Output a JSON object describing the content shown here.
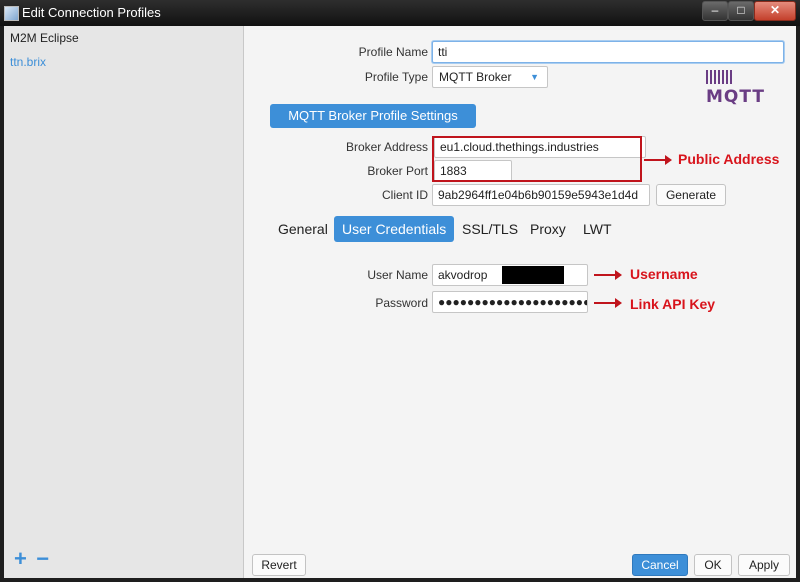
{
  "window": {
    "title": "Edit Connection Profiles",
    "minimize": "‒",
    "maximize": "□",
    "close": "✕"
  },
  "sidebar": {
    "profiles": [
      {
        "label": "M2M Eclipse"
      },
      {
        "label": "ttn.brix"
      }
    ],
    "add": "+",
    "remove": "−"
  },
  "profile": {
    "name_label": "Profile Name",
    "name_value": "tti",
    "type_label": "Profile Type",
    "type_value": "MQTT Broker"
  },
  "logo": {
    "text": "MQTT"
  },
  "section": {
    "title": "MQTT Broker Profile Settings"
  },
  "broker": {
    "address_label": "Broker Address",
    "address_value": "eu1.cloud.thethings.industries",
    "port_label": "Broker Port",
    "port_value": "1883",
    "client_label": "Client ID",
    "client_value": "9ab2964ff1e04b6b90159e5943e1d4d",
    "generate_label": "Generate"
  },
  "tabs": [
    {
      "label": "General"
    },
    {
      "label": "User Credentials"
    },
    {
      "label": "SSL/TLS"
    },
    {
      "label": "Proxy"
    },
    {
      "label": "LWT"
    }
  ],
  "credentials": {
    "username_label": "User Name",
    "username_value": "akvodrop",
    "password_label": "Password",
    "password_value": "●●●●●●●●●●●●●●●●●●●●●"
  },
  "annotations": {
    "public_address": "Public Address",
    "username": "Username",
    "api_key": "Link API Key"
  },
  "buttons": {
    "revert": "Revert",
    "cancel": "Cancel",
    "ok": "OK",
    "apply": "Apply"
  },
  "colors": {
    "accent": "#3d8fd8",
    "annotation": "#d8141c"
  }
}
